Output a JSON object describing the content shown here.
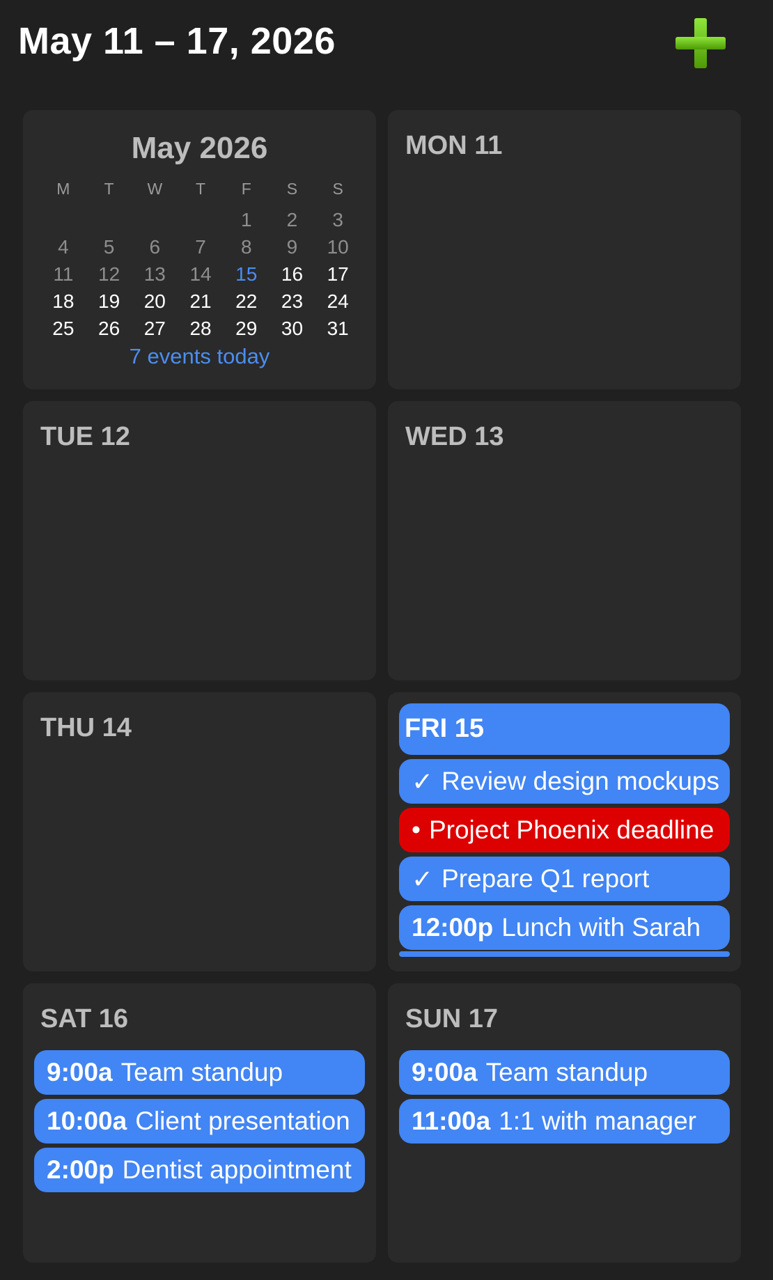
{
  "header": {
    "title": "May 11 – 17, 2026",
    "add_icon_color": "#6cc20a"
  },
  "mini_calendar": {
    "month": "May 2026",
    "dow": [
      "M",
      "T",
      "W",
      "T",
      "F",
      "S",
      "S"
    ],
    "weeks": [
      [
        "",
        "",
        "",
        "",
        "1",
        "2",
        "3"
      ],
      [
        "4",
        "5",
        "6",
        "7",
        "8",
        "9",
        "10"
      ],
      [
        "11",
        "12",
        "13",
        "14",
        "15",
        "16",
        "17"
      ],
      [
        "18",
        "19",
        "20",
        "21",
        "22",
        "23",
        "24"
      ],
      [
        "25",
        "26",
        "27",
        "28",
        "29",
        "30",
        "31"
      ]
    ],
    "today": "15",
    "summary": "7 events today"
  },
  "days": {
    "mon": {
      "label": "MON 11"
    },
    "tue": {
      "label": "TUE 12"
    },
    "wed": {
      "label": "WED 13"
    },
    "thu": {
      "label": "THU 14"
    },
    "fri": {
      "label": "FRI 15",
      "events": [
        {
          "mark": "✓",
          "title": "Review design mockups",
          "color": "#4285f4"
        },
        {
          "mark": "•",
          "title": "Project Phoenix deadline",
          "color": "#dd0000"
        },
        {
          "mark": "✓",
          "title": "Prepare Q1 report",
          "color": "#4285f4"
        },
        {
          "time": "12:00p",
          "title": "Lunch with Sarah",
          "color": "#4285f4"
        }
      ]
    },
    "sat": {
      "label": "SAT 16",
      "events": [
        {
          "time": "9:00a",
          "title": "Team standup"
        },
        {
          "time": "10:00a",
          "title": "Client presentation"
        },
        {
          "time": "2:00p",
          "title": "Dentist appointment"
        }
      ]
    },
    "sun": {
      "label": "SUN 17",
      "events": [
        {
          "time": "9:00a",
          "title": "Team standup"
        },
        {
          "time": "11:00a",
          "title": "1:1 with manager"
        }
      ]
    }
  },
  "colors": {
    "background": "#202020",
    "cell": "#2a2a2a",
    "event_blue": "#4285f4",
    "deadline_red": "#dd0000",
    "today_blue": "#4a8ef0"
  }
}
